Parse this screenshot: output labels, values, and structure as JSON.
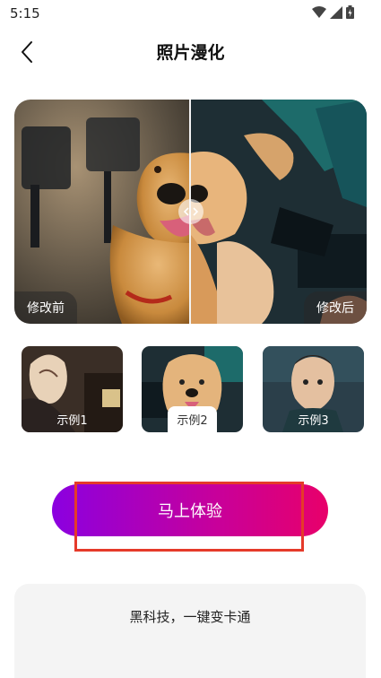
{
  "status_bar": {
    "time": "5:15",
    "icons": [
      "wifi-icon",
      "signal-icon",
      "battery-icon"
    ]
  },
  "header": {
    "title": "照片漫化",
    "back_icon": "chevron-left-icon"
  },
  "compare": {
    "before_label": "修改前",
    "after_label": "修改后"
  },
  "examples": [
    {
      "label": "示例1",
      "active": false
    },
    {
      "label": "示例2",
      "active": true
    },
    {
      "label": "示例3",
      "active": false
    }
  ],
  "cta": {
    "label": "马上体验"
  },
  "info": {
    "text": "黑科技，一键变卡通"
  },
  "colors": {
    "cta_start": "#8b00e0",
    "cta_end": "#e8006a",
    "highlight": "#e53a2a"
  }
}
